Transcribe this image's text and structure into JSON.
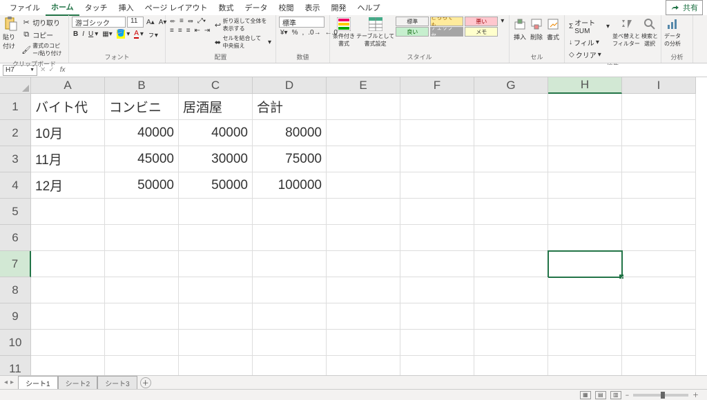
{
  "tabs": {
    "file": "ファイル",
    "home": "ホーム",
    "touch": "タッチ",
    "insert": "挿入",
    "pageLayout": "ページ レイアウト",
    "formulas": "数式",
    "data": "データ",
    "review": "校閲",
    "view": "表示",
    "developer": "開発",
    "help": "ヘルプ"
  },
  "share": "共有",
  "ribbon": {
    "clipboard": {
      "paste": "貼り付け",
      "cut": "切り取り",
      "copy": "コピー",
      "fmt": "書式のコピー/貼り付け",
      "label": "クリップボード"
    },
    "font": {
      "name": "游ゴシック",
      "size": "11",
      "label": "フォント"
    },
    "align": {
      "wrap": "折り返して全体を表示する",
      "merge": "セルを結合して中央揃え",
      "label": "配置"
    },
    "number": {
      "fmt": "標準",
      "label": "数値"
    },
    "styles": {
      "cond": "条件付き\n書式",
      "table": "テーブルとして\n書式設定",
      "normal": "標準",
      "neutral": "どちらでも…",
      "bad": "悪い",
      "good": "良い",
      "check": "チェック セ…",
      "memo": "メモ",
      "label": "スタイル"
    },
    "cells": {
      "insert": "挿入",
      "delete": "削除",
      "format": "書式",
      "label": "セル"
    },
    "editing": {
      "autosum": "オート SUM",
      "fill": "フィル",
      "clear": "クリア",
      "sort": "並べ替えと\nフィルター",
      "find": "検索と\n選択",
      "label": "編集"
    },
    "analysis": {
      "btn": "データ\nの分析",
      "label": "分析"
    }
  },
  "namebox": "H7",
  "columns": [
    "A",
    "B",
    "C",
    "D",
    "E",
    "F",
    "G",
    "H",
    "I"
  ],
  "rows": [
    "1",
    "2",
    "3",
    "4",
    "5",
    "6",
    "7",
    "8",
    "9",
    "10",
    "11"
  ],
  "cells": {
    "A1": "バイト代",
    "B1": "コンビニ",
    "C1": "居酒屋",
    "D1": "合計",
    "A2": "10月",
    "B2": "40000",
    "C2": "40000",
    "D2": "80000",
    "A3": "11月",
    "B3": "45000",
    "C3": "30000",
    "D3": "75000",
    "A4": "12月",
    "B4": "50000",
    "C4": "50000",
    "D4": "100000"
  },
  "activeCell": "H7",
  "sheets": {
    "s1": "シート1",
    "s2": "シート2",
    "s3": "シート3"
  },
  "status": {
    "ready": "",
    "zoom": ""
  }
}
